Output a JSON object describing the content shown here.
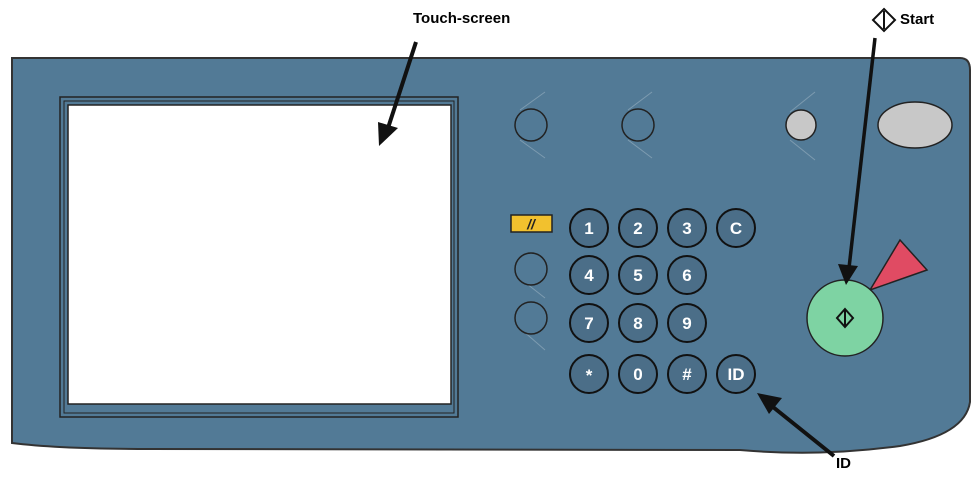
{
  "labels": {
    "touch_screen": "Touch-screen",
    "start": "Start",
    "id": "ID"
  },
  "keypad": {
    "rows": [
      [
        "1",
        "2",
        "3",
        "C"
      ],
      [
        "4",
        "5",
        "6"
      ],
      [
        "7",
        "8",
        "9"
      ],
      [
        "*",
        "0",
        "#",
        "ID"
      ]
    ],
    "interrupt_label": "//"
  },
  "colors": {
    "panel": "#527a96",
    "panel_edge": "#3a3a3a",
    "key_fill": "#4b6e88",
    "start_button": "#7ed3a3",
    "start_indicator": "#e04b63",
    "interrupt_key": "#f2c12e",
    "gray_button": "#c8c8c8"
  },
  "icons": {
    "start_symbol": "start-diamond-icon"
  }
}
